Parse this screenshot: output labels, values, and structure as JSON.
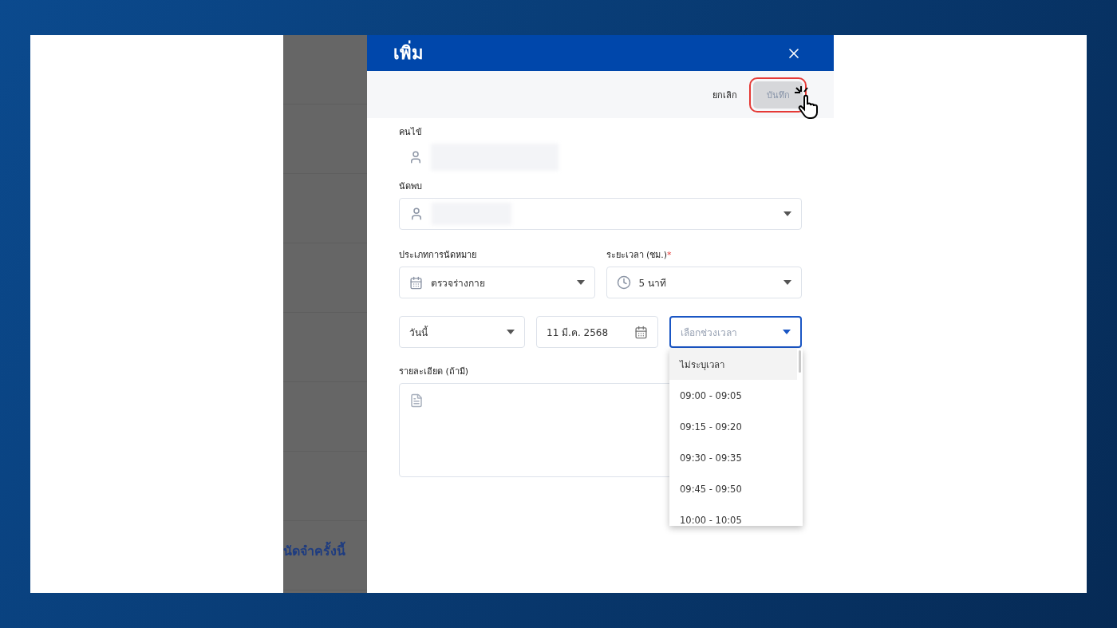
{
  "background_page": {
    "heading": "นัดจำครั้งนี้"
  },
  "modal": {
    "title": "เพิ่ม"
  },
  "toolbar": {
    "cancel": "ยกเลิก",
    "save": {
      "label": "บันทึก",
      "disabled": true,
      "highlighted": true
    }
  },
  "patient": {
    "label": "คนไข้",
    "redacted": true
  },
  "doctor": {
    "label": "นัดพบ",
    "redacted": true
  },
  "appointment_type": {
    "label": "ประเภทการนัดหมาย",
    "value": "ตรวจร่างกาย"
  },
  "duration": {
    "label": "ระยะเวลา (ชม.)",
    "required_mark": "*",
    "value": "5 นาที"
  },
  "day": {
    "value": "วันนี้"
  },
  "date": {
    "value": "11 มี.ค. 2568"
  },
  "time_slot": {
    "placeholder": "เลือกช่วงเวลา",
    "focused": true,
    "expanded": true
  },
  "time_options": [
    {
      "label": "ไม่ระบุเวลา",
      "selected": true
    },
    {
      "label": "09:00 - 09:05",
      "selected": false
    },
    {
      "label": "09:15 - 09:20",
      "selected": false
    },
    {
      "label": "09:30 - 09:35",
      "selected": false
    },
    {
      "label": "09:45 - 09:50",
      "selected": false
    },
    {
      "label": "10:00 - 10:05",
      "selected": false
    }
  ],
  "notes": {
    "label": "รายละเอียด (ถ้ามี)"
  }
}
